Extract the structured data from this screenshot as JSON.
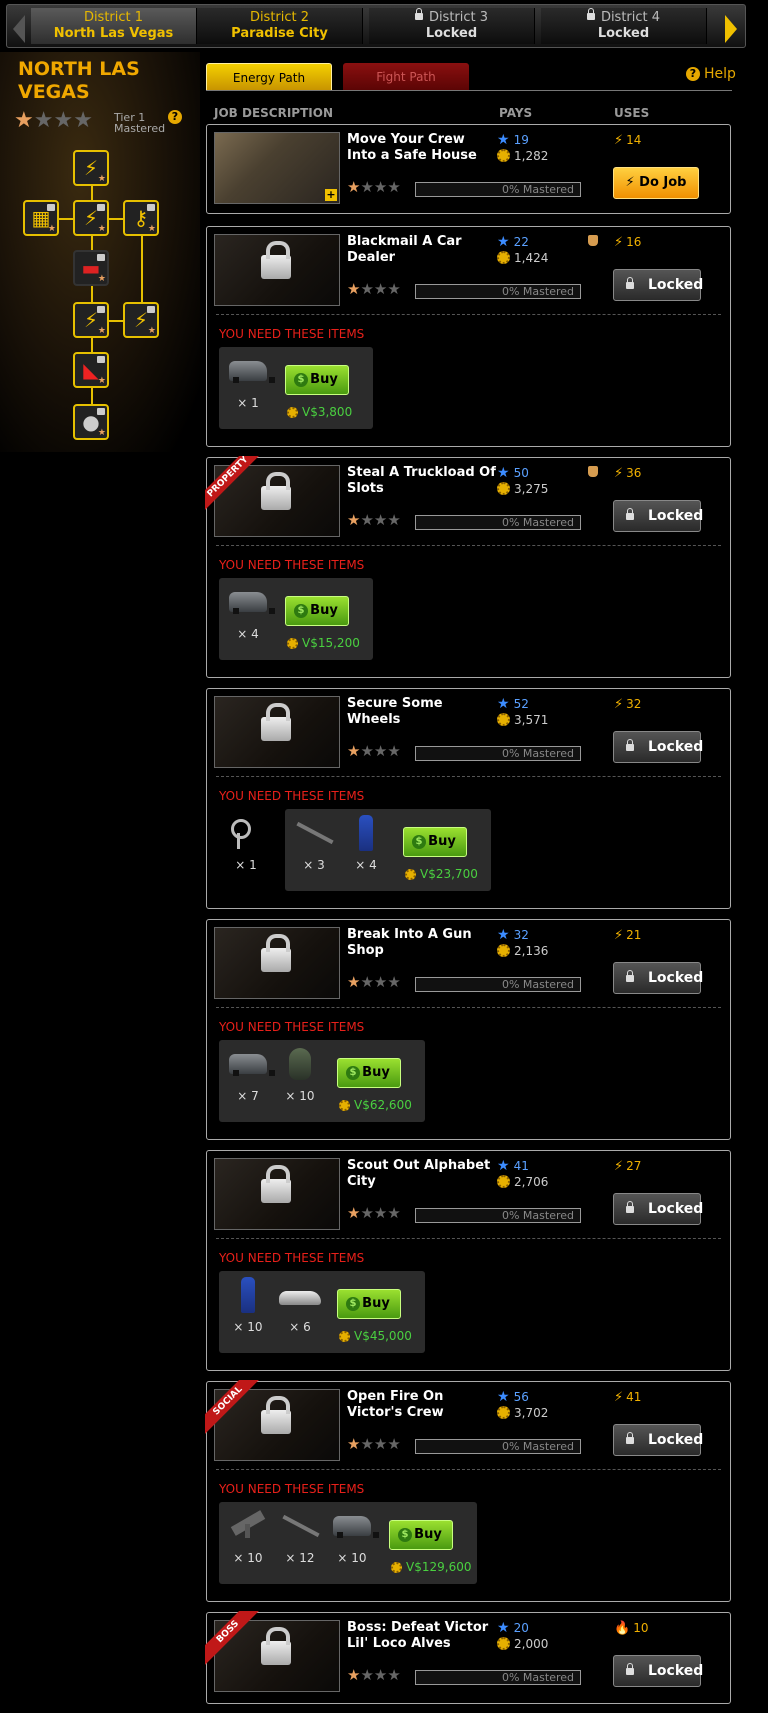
{
  "districts": [
    {
      "num": "District 1",
      "name": "North Las Vegas"
    },
    {
      "num": "District 2",
      "name": "Paradise City"
    },
    {
      "num": "District 3",
      "name": "Locked"
    },
    {
      "num": "District 4",
      "name": "Locked"
    }
  ],
  "district_title": "NORTH LAS VEGAS",
  "tier": {
    "label": "Tier 1",
    "status": "Mastered",
    "stars": 1,
    "max_stars": 4
  },
  "tabs": {
    "energy": "Energy Path",
    "fight": "Fight Path"
  },
  "help": "Help",
  "columns": {
    "job": "JOB DESCRIPTION",
    "pays": "PAYS",
    "uses": "USES"
  },
  "mastery_text": "0% Mastered",
  "need_items": "YOU NEED THESE ITEMS",
  "buy_label": "Buy",
  "do_job_label": "Do Job",
  "locked_label": "Locked",
  "jobs": [
    {
      "name": "Move Your Crew Into a Safe House",
      "xp": "19",
      "vd": "1,282",
      "uses": "14",
      "ribbon": ""
    },
    {
      "name": "Blackmail A Car Dealer",
      "xp": "22",
      "vd": "1,424",
      "uses": "16",
      "ribbon": "",
      "items": [
        {
          "type": "van",
          "qty": "× 1"
        }
      ],
      "cost": "V$3,800"
    },
    {
      "name": "Steal A Truckload Of Slots",
      "xp": "50",
      "vd": "3,275",
      "uses": "36",
      "ribbon": "PROPERTY",
      "items": [
        {
          "type": "van",
          "qty": "× 4"
        }
      ],
      "cost": "V$15,200"
    },
    {
      "name": "Secure Some Wheels",
      "xp": "52",
      "vd": "3,571",
      "uses": "32",
      "ribbon": "",
      "owned_items": [
        {
          "type": "key",
          "qty": "× 1"
        }
      ],
      "items": [
        {
          "type": "gun",
          "qty": "× 3"
        },
        {
          "type": "suit",
          "qty": "× 4"
        }
      ],
      "cost": "V$23,700"
    },
    {
      "name": "Break Into A Gun Shop",
      "xp": "32",
      "vd": "2,136",
      "uses": "21",
      "ribbon": "",
      "items": [
        {
          "type": "van",
          "qty": "× 7"
        },
        {
          "type": "mask",
          "qty": "× 10"
        }
      ],
      "cost": "V$62,600"
    },
    {
      "name": "Scout Out Alphabet City",
      "xp": "41",
      "vd": "2,706",
      "uses": "27",
      "ribbon": "",
      "items": [
        {
          "type": "suit",
          "qty": "× 10"
        },
        {
          "type": "car",
          "qty": "× 6"
        }
      ],
      "cost": "V$45,000"
    },
    {
      "name": "Open Fire On Victor's Crew",
      "xp": "56",
      "vd": "3,702",
      "uses": "41",
      "ribbon": "SOCIAL",
      "items": [
        {
          "type": "uzi",
          "qty": "× 10"
        },
        {
          "type": "gun",
          "qty": "× 12"
        },
        {
          "type": "van",
          "qty": "× 10"
        }
      ],
      "cost": "V$129,600"
    },
    {
      "name": "Boss: Defeat Victor Lil' Loco Alves",
      "xp": "20",
      "vd": "2,000",
      "uses": "10",
      "ribbon": "BOSS"
    }
  ]
}
